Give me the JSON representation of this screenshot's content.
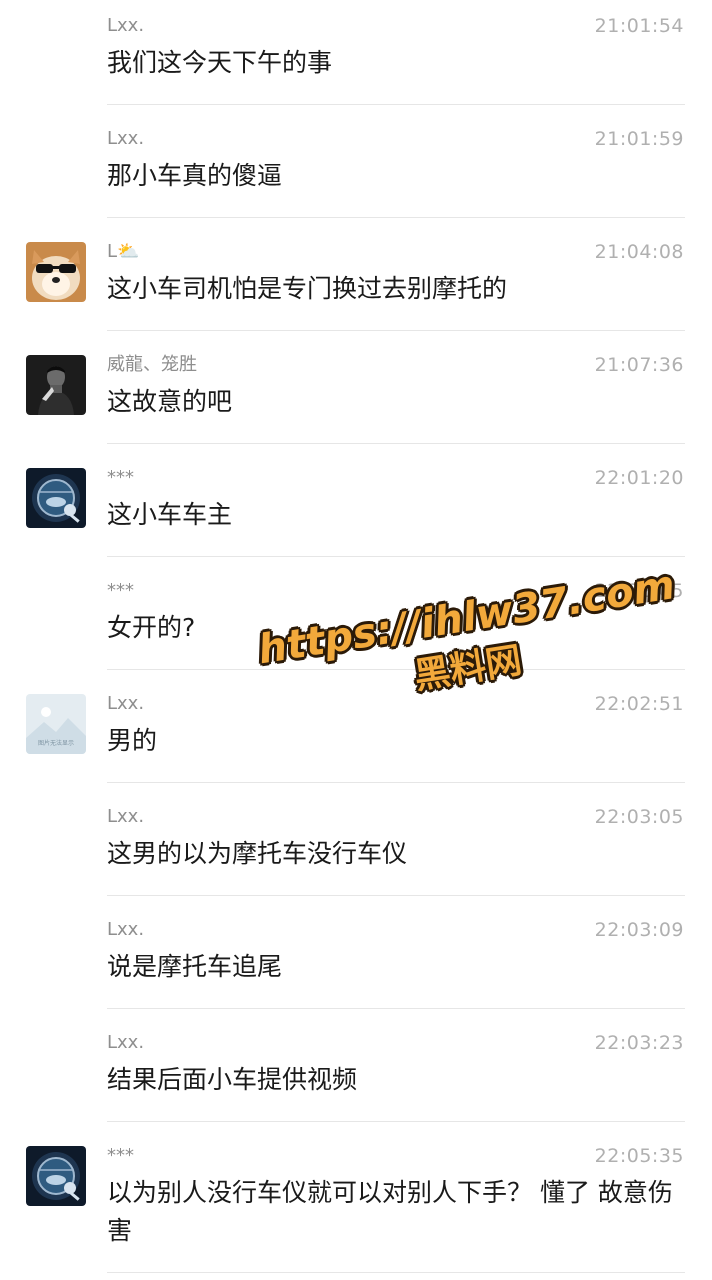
{
  "messages": [
    {
      "sender": "Lxx.",
      "time": "21:01:54",
      "text": "我们这今天下午的事",
      "avatar": null
    },
    {
      "sender": "Lxx.",
      "time": "21:01:59",
      "text": "那小车真的傻逼",
      "avatar": null
    },
    {
      "sender": "L",
      "sender_emoji": "⛅",
      "time": "21:04:08",
      "text": "这小车司机怕是专门换过去别摩托的",
      "avatar": "dog-sunglasses-avatar"
    },
    {
      "sender": "威龍、笼胜",
      "time": "21:07:36",
      "text": "这故意的吧",
      "avatar": "man-portrait-avatar"
    },
    {
      "sender": "***",
      "time": "22:01:20",
      "text": "这小车车主",
      "avatar": "space-porthole-avatar"
    },
    {
      "sender": "***",
      "time": "22:02:05",
      "text": "女开的?",
      "avatar": null
    },
    {
      "sender": "Lxx.",
      "time": "22:02:51",
      "text": "男的",
      "avatar": "image-failed-avatar",
      "avatar_caption": "图片无法显示"
    },
    {
      "sender": "Lxx.",
      "time": "22:03:05",
      "text": "这男的以为摩托车没行车仪",
      "avatar": null
    },
    {
      "sender": "Lxx.",
      "time": "22:03:09",
      "text": "说是摩托车追尾",
      "avatar": null
    },
    {
      "sender": "Lxx.",
      "time": "22:03:23",
      "text": "结果后面小车提供视频",
      "avatar": null
    },
    {
      "sender": "***",
      "time": "22:05:35",
      "text": "以为别人没行车仪就可以对别人下手？ 懂了 故意伤害",
      "avatar": "space-porthole-avatar"
    }
  ],
  "watermark": {
    "url": "https://ihlw37.com",
    "label": "黑料网"
  },
  "colors": {
    "sender": "#8e8e8e",
    "time": "#b0b0b0",
    "text": "#1a1a1a",
    "divider": "#e6e6e6",
    "watermark_fill": "#f2a93b",
    "watermark_outline": "#2b1a08"
  }
}
